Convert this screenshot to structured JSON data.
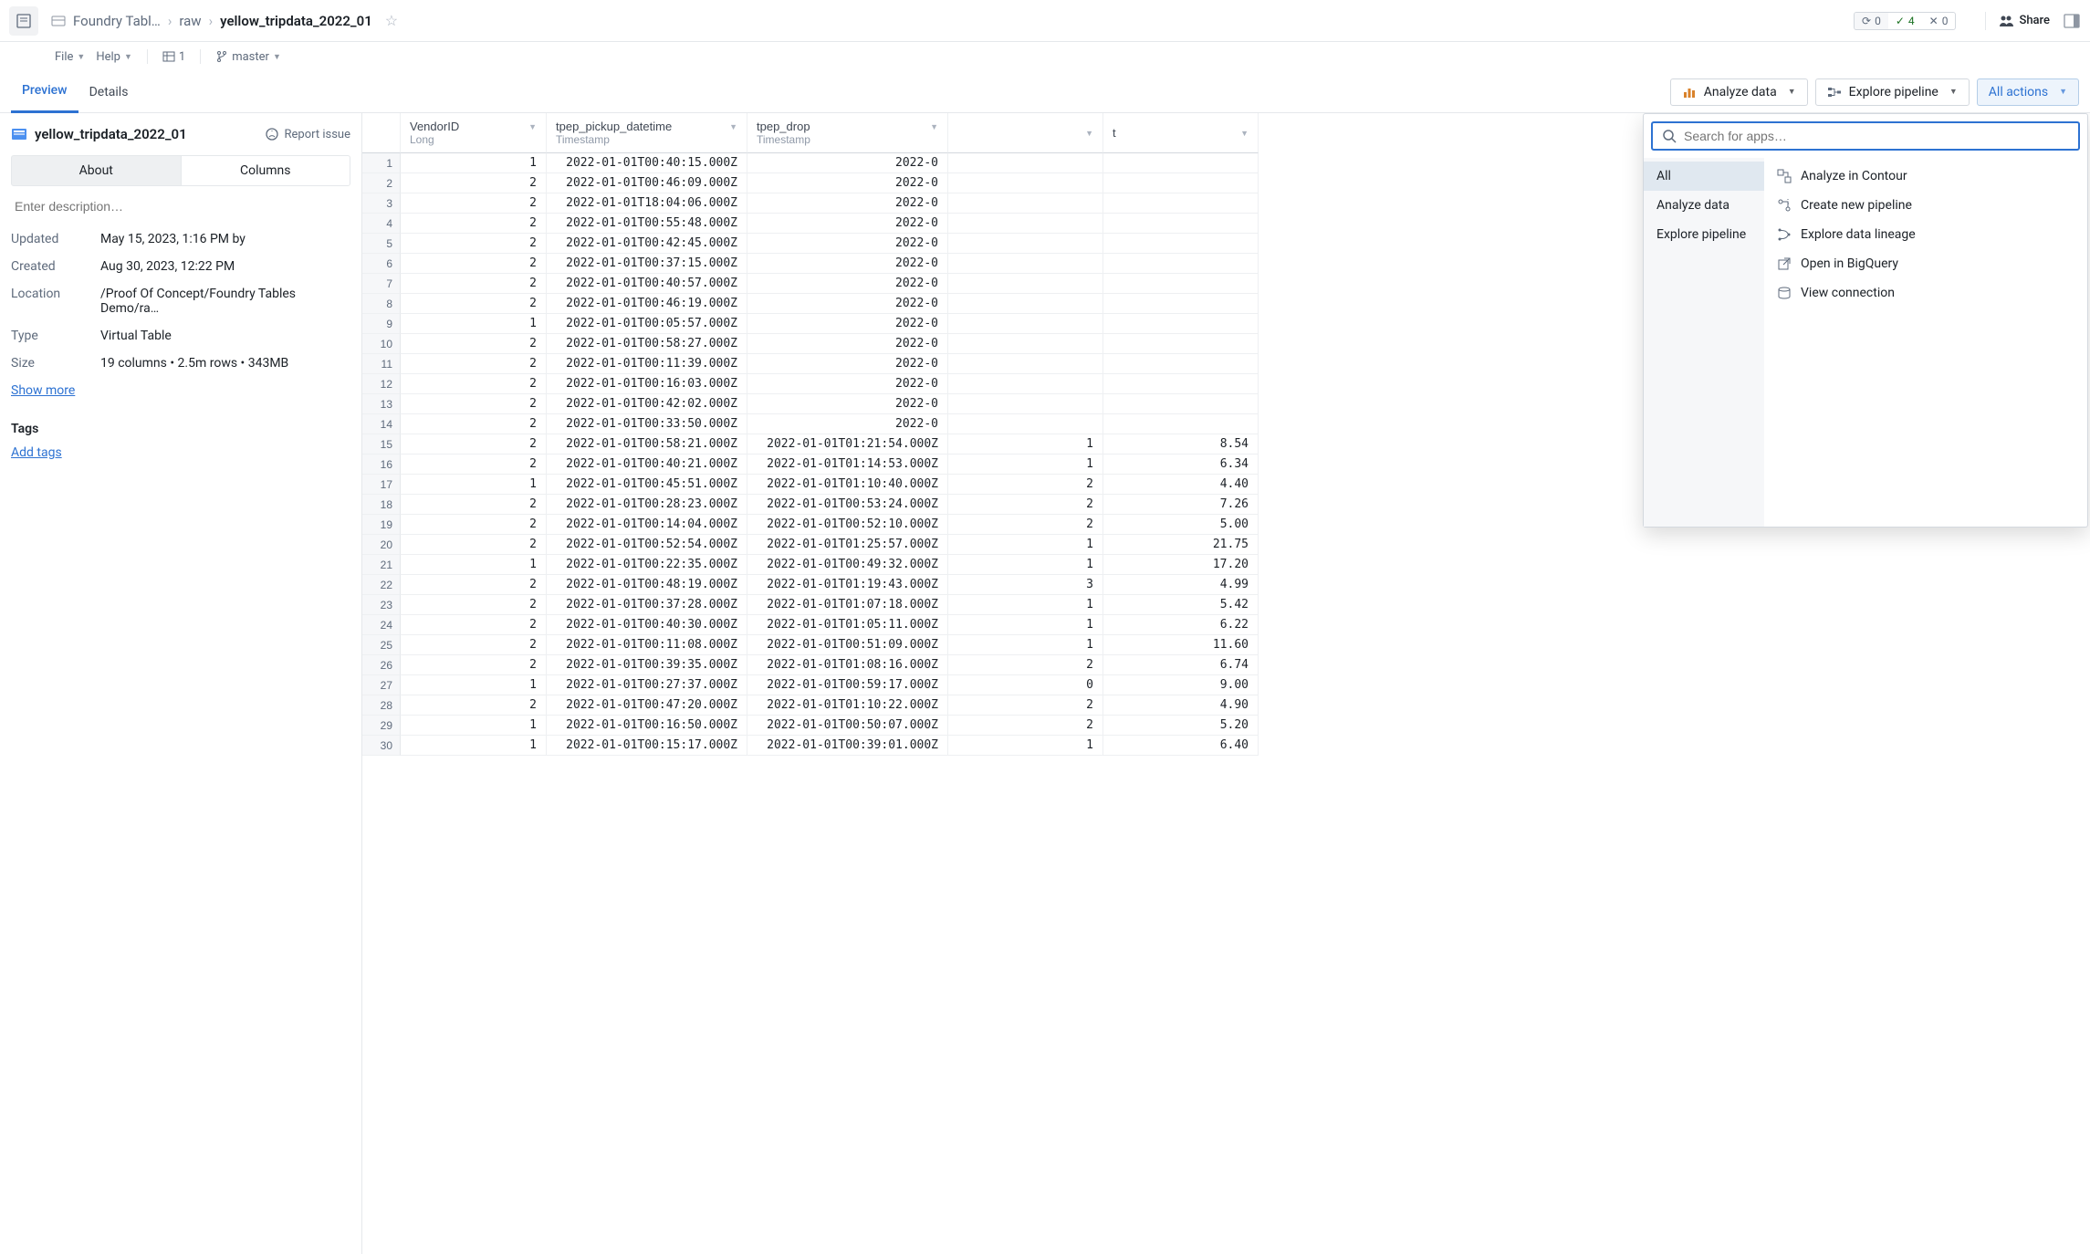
{
  "breadcrumbs": {
    "root": "Foundry Tabl…",
    "folder": "raw",
    "current": "yellow_tripdata_2022_01"
  },
  "menus": {
    "file": "File",
    "help": "Help",
    "count1": "1",
    "branch": "master"
  },
  "status": {
    "sync": "0",
    "ok": "4",
    "x": "0"
  },
  "share": "Share",
  "tabs": {
    "preview": "Preview",
    "details": "Details"
  },
  "actions": {
    "analyze": "Analyze data",
    "explore": "Explore pipeline",
    "all": "All actions"
  },
  "dataset": {
    "name": "yellow_tripdata_2022_01",
    "report": "Report issue"
  },
  "side_tabs": {
    "about": "About",
    "columns": "Columns"
  },
  "desc_placeholder": "Enter description…",
  "meta": {
    "updated_l": "Updated",
    "updated_v": "May 15, 2023, 1:16 PM by",
    "created_l": "Created",
    "created_v": "Aug 30, 2023, 12:22 PM",
    "location_l": "Location",
    "location_v": "/Proof Of Concept/Foundry Tables Demo/ra…",
    "type_l": "Type",
    "type_v": "Virtual Table",
    "size_l": "Size",
    "size_v": "19 columns • 2.5m rows • 343MB"
  },
  "show_more": "Show more",
  "tags_title": "Tags",
  "add_tags": "Add tags",
  "columns": [
    {
      "name": "VendorID",
      "type": "Long"
    },
    {
      "name": "tpep_pickup_datetime",
      "type": "Timestamp"
    },
    {
      "name": "tpep_drop",
      "type": "Timestamp"
    },
    {
      "name": "",
      "type": ""
    },
    {
      "name": "t",
      "type": ""
    }
  ],
  "rows": [
    {
      "n": 1,
      "v": [
        "1",
        "2022-01-01T00:40:15.000Z",
        "2022-0",
        "",
        ""
      ]
    },
    {
      "n": 2,
      "v": [
        "2",
        "2022-01-01T00:46:09.000Z",
        "2022-0",
        "",
        ""
      ]
    },
    {
      "n": 3,
      "v": [
        "2",
        "2022-01-01T18:04:06.000Z",
        "2022-0",
        "",
        ""
      ]
    },
    {
      "n": 4,
      "v": [
        "2",
        "2022-01-01T00:55:48.000Z",
        "2022-0",
        "",
        ""
      ]
    },
    {
      "n": 5,
      "v": [
        "2",
        "2022-01-01T00:42:45.000Z",
        "2022-0",
        "",
        ""
      ]
    },
    {
      "n": 6,
      "v": [
        "2",
        "2022-01-01T00:37:15.000Z",
        "2022-0",
        "",
        ""
      ]
    },
    {
      "n": 7,
      "v": [
        "2",
        "2022-01-01T00:40:57.000Z",
        "2022-0",
        "",
        ""
      ]
    },
    {
      "n": 8,
      "v": [
        "2",
        "2022-01-01T00:46:19.000Z",
        "2022-0",
        "",
        ""
      ]
    },
    {
      "n": 9,
      "v": [
        "1",
        "2022-01-01T00:05:57.000Z",
        "2022-0",
        "",
        ""
      ]
    },
    {
      "n": 10,
      "v": [
        "2",
        "2022-01-01T00:58:27.000Z",
        "2022-0",
        "",
        ""
      ]
    },
    {
      "n": 11,
      "v": [
        "2",
        "2022-01-01T00:11:39.000Z",
        "2022-0",
        "",
        ""
      ]
    },
    {
      "n": 12,
      "v": [
        "2",
        "2022-01-01T00:16:03.000Z",
        "2022-0",
        "",
        ""
      ]
    },
    {
      "n": 13,
      "v": [
        "2",
        "2022-01-01T00:42:02.000Z",
        "2022-0",
        "",
        ""
      ]
    },
    {
      "n": 14,
      "v": [
        "2",
        "2022-01-01T00:33:50.000Z",
        "2022-0",
        "",
        ""
      ]
    },
    {
      "n": 15,
      "v": [
        "2",
        "2022-01-01T00:58:21.000Z",
        "2022-01-01T01:21:54.000Z",
        "1",
        "8.54"
      ]
    },
    {
      "n": 16,
      "v": [
        "2",
        "2022-01-01T00:40:21.000Z",
        "2022-01-01T01:14:53.000Z",
        "1",
        "6.34"
      ]
    },
    {
      "n": 17,
      "v": [
        "1",
        "2022-01-01T00:45:51.000Z",
        "2022-01-01T01:10:40.000Z",
        "2",
        "4.40"
      ]
    },
    {
      "n": 18,
      "v": [
        "2",
        "2022-01-01T00:28:23.000Z",
        "2022-01-01T00:53:24.000Z",
        "2",
        "7.26"
      ]
    },
    {
      "n": 19,
      "v": [
        "2",
        "2022-01-01T00:14:04.000Z",
        "2022-01-01T00:52:10.000Z",
        "2",
        "5.00"
      ]
    },
    {
      "n": 20,
      "v": [
        "2",
        "2022-01-01T00:52:54.000Z",
        "2022-01-01T01:25:57.000Z",
        "1",
        "21.75"
      ]
    },
    {
      "n": 21,
      "v": [
        "1",
        "2022-01-01T00:22:35.000Z",
        "2022-01-01T00:49:32.000Z",
        "1",
        "17.20"
      ]
    },
    {
      "n": 22,
      "v": [
        "2",
        "2022-01-01T00:48:19.000Z",
        "2022-01-01T01:19:43.000Z",
        "3",
        "4.99"
      ]
    },
    {
      "n": 23,
      "v": [
        "2",
        "2022-01-01T00:37:28.000Z",
        "2022-01-01T01:07:18.000Z",
        "1",
        "5.42"
      ]
    },
    {
      "n": 24,
      "v": [
        "2",
        "2022-01-01T00:40:30.000Z",
        "2022-01-01T01:05:11.000Z",
        "1",
        "6.22"
      ]
    },
    {
      "n": 25,
      "v": [
        "2",
        "2022-01-01T00:11:08.000Z",
        "2022-01-01T00:51:09.000Z",
        "1",
        "11.60"
      ]
    },
    {
      "n": 26,
      "v": [
        "2",
        "2022-01-01T00:39:35.000Z",
        "2022-01-01T01:08:16.000Z",
        "2",
        "6.74"
      ]
    },
    {
      "n": 27,
      "v": [
        "1",
        "2022-01-01T00:27:37.000Z",
        "2022-01-01T00:59:17.000Z",
        "0",
        "9.00"
      ]
    },
    {
      "n": 28,
      "v": [
        "2",
        "2022-01-01T00:47:20.000Z",
        "2022-01-01T01:10:22.000Z",
        "2",
        "4.90"
      ]
    },
    {
      "n": 29,
      "v": [
        "1",
        "2022-01-01T00:16:50.000Z",
        "2022-01-01T00:50:07.000Z",
        "2",
        "5.20"
      ]
    },
    {
      "n": 30,
      "v": [
        "1",
        "2022-01-01T00:15:17.000Z",
        "2022-01-01T00:39:01.000Z",
        "1",
        "6.40"
      ]
    }
  ],
  "popover": {
    "search_placeholder": "Search for apps…",
    "left": [
      "All",
      "Analyze data",
      "Explore pipeline"
    ],
    "right": [
      "Analyze in Contour",
      "Create new pipeline",
      "Explore data lineage",
      "Open in BigQuery",
      "View connection"
    ]
  }
}
